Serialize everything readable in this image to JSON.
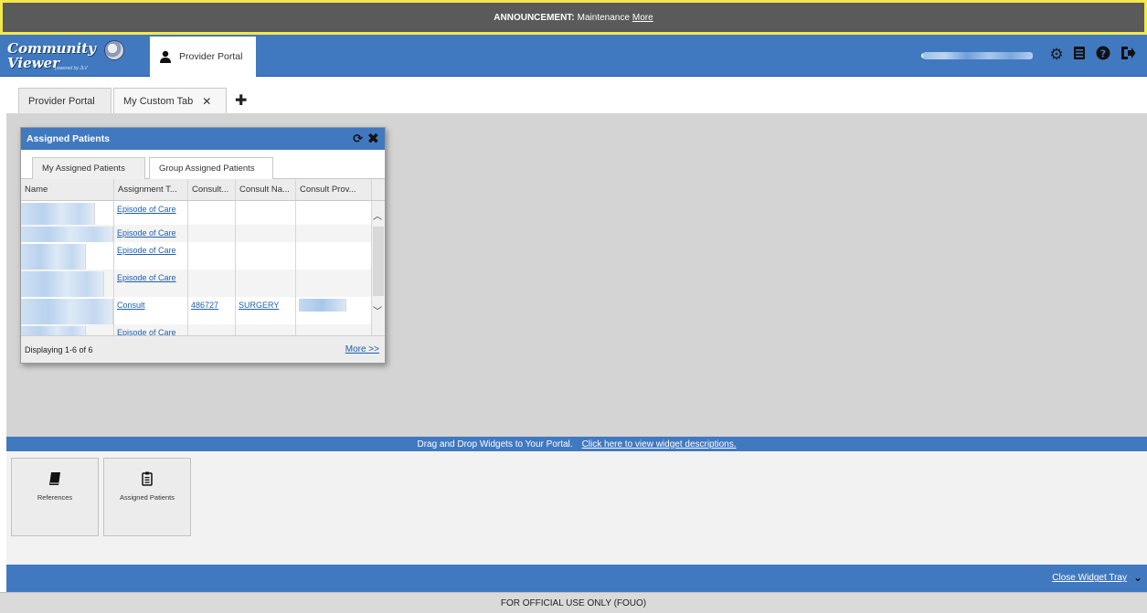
{
  "announcement": {
    "label": "ANNOUNCEMENT:",
    "text": "Maintenance",
    "link": "More"
  },
  "header": {
    "logo_line1": "Community",
    "logo_line2": "Viewer",
    "logo_sub": "powered by JLV",
    "active_portal": "Provider Portal",
    "icons": [
      "gear-icon",
      "list-icon",
      "help-icon",
      "logout-icon"
    ]
  },
  "tabs": [
    {
      "label": "Provider Portal"
    },
    {
      "label": "My Custom Tab"
    }
  ],
  "widget": {
    "title": "Assigned Patients",
    "tabs": [
      "My Assigned Patients",
      "Group Assigned Patients"
    ],
    "columns": [
      "Name",
      "Assignment T...",
      "Consult...",
      "Consult Na...",
      "Consult Prov..."
    ],
    "rows": [
      {
        "assignment": "Episode of Care",
        "consult": "",
        "consult_name": ""
      },
      {
        "assignment": "Episode of Care",
        "consult": "",
        "consult_name": ""
      },
      {
        "assignment": "Episode of Care",
        "consult": "",
        "consult_name": ""
      },
      {
        "assignment": "Episode of Care",
        "consult": "",
        "consult_name": ""
      },
      {
        "assignment": "Consult",
        "consult": "486727",
        "consult_name": "SURGERY"
      },
      {
        "assignment": "Episode of Care",
        "consult": "",
        "consult_name": ""
      }
    ],
    "footer_text": "Displaying 1-6 of 6",
    "more_link": "More >>"
  },
  "dragbar": {
    "text": "Drag and Drop Widgets to Your Portal.",
    "link": "Click here to view widget descriptions."
  },
  "tray": {
    "tiles": [
      {
        "label": "References",
        "icon": "book-icon"
      },
      {
        "label": "Assigned Patients",
        "icon": "clipboard-icon"
      }
    ],
    "close_label": "Close Widget Tray"
  },
  "footer": {
    "text": "FOR OFFICIAL USE ONLY (FOUO)"
  },
  "colors": {
    "header_blue": "#4179c0",
    "announce_border": "#f2e84a",
    "workspace_gray": "#d4d4d4"
  }
}
